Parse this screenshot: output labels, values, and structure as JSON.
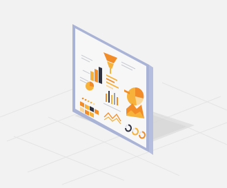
{
  "illustration": {
    "subject": "isometric-dashboard-panel",
    "colors": {
      "background": "#f2f2f2",
      "frame": "#a9b3d6",
      "panel": "#f7f7f8",
      "shadow": "#d8d8d8",
      "grid": "#e4e4e4",
      "accent_orange": "#f28c28",
      "accent_amber": "#f6b23a",
      "accent_light": "#fbd79a",
      "accent_dark": "#2f3140",
      "text_gray": "#9aa0a8"
    },
    "icons": [
      "funnel-chart-icon",
      "bar-chart-icon",
      "pie-chart-icon",
      "donut-chart-icon",
      "line-chart-icon",
      "area-chart-icon",
      "progress-ring-icon",
      "calendar-grid-icon"
    ]
  }
}
